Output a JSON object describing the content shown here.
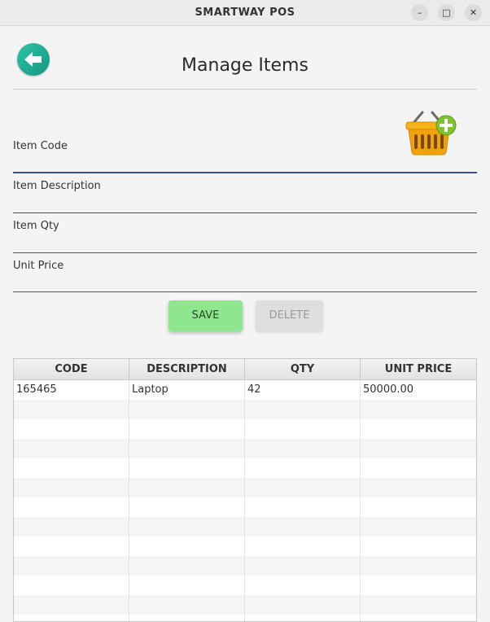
{
  "window": {
    "title": "SMARTWAY POS",
    "minimize_glyph": "–",
    "maximize_glyph": "□",
    "close_glyph": "✕"
  },
  "header": {
    "title": "Manage Items"
  },
  "form": {
    "item_code_label": "Item Code",
    "item_code_value": "",
    "item_description_label": "Item Description",
    "item_description_value": "",
    "item_qty_label": "Item Qty",
    "item_qty_value": "",
    "unit_price_label": "Unit Price",
    "unit_price_value": ""
  },
  "actions": {
    "save_label": "SAVE",
    "delete_label": "DELETE"
  },
  "table": {
    "columns": [
      "CODE",
      "DESCRIPTION",
      "QTY",
      "UNIT PRICE"
    ],
    "rows": [
      [
        "165465",
        "Laptop",
        "42",
        "50000.00"
      ]
    ]
  },
  "colors": {
    "accent_teal": "#1aa88f",
    "save_green": "#8ee68e",
    "focus_underline": "#3d4aa8",
    "basket_orange": "#f2a20c"
  },
  "icons": {
    "back": "arrow-left-icon",
    "add_item": "basket-add-icon"
  }
}
